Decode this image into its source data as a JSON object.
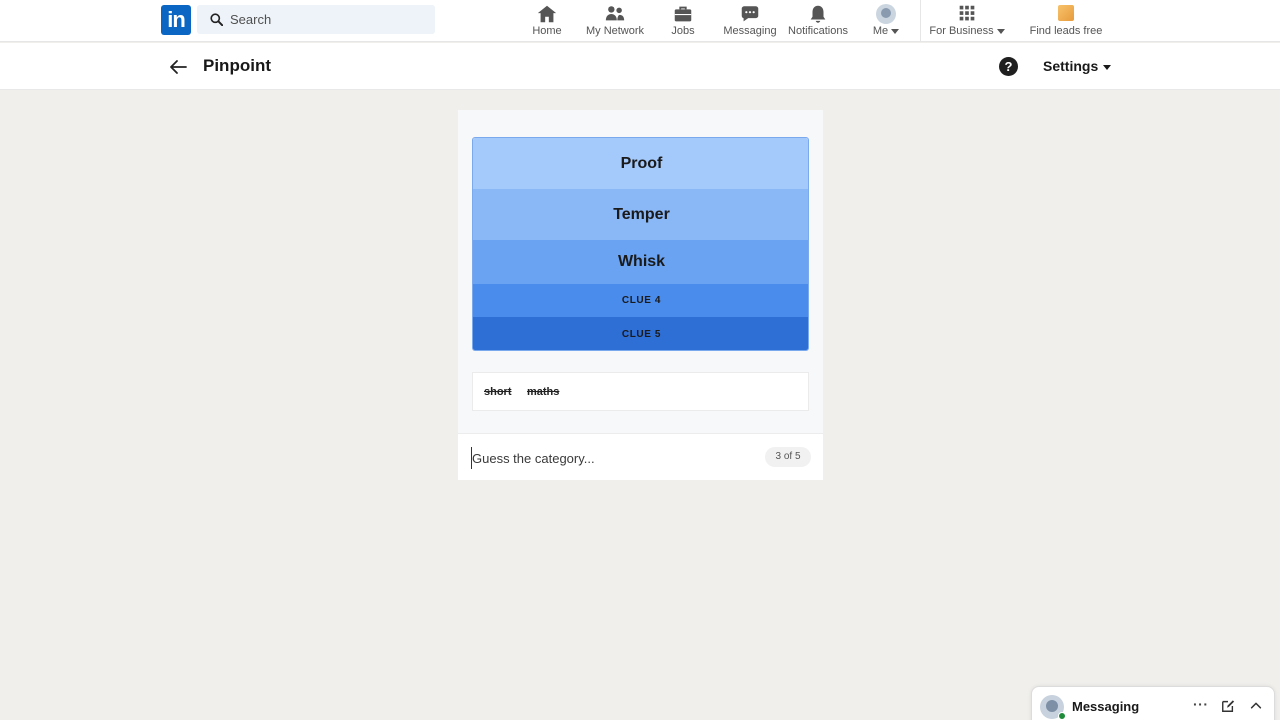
{
  "topnav": {
    "logo_text": "in",
    "search": {
      "placeholder": "Search"
    },
    "items": [
      {
        "label": "Home",
        "icon": "home-icon"
      },
      {
        "label": "My Network",
        "icon": "people-icon"
      },
      {
        "label": "Jobs",
        "icon": "briefcase-icon"
      },
      {
        "label": "Messaging",
        "icon": "chat-icon"
      },
      {
        "label": "Notifications",
        "icon": "bell-icon"
      },
      {
        "label": "Me",
        "icon": "avatar"
      },
      {
        "label": "For Business",
        "icon": "grid-icon"
      },
      {
        "label": "Find leads free",
        "icon": "leads-icon"
      }
    ]
  },
  "header": {
    "title": "Pinpoint",
    "help": "?",
    "settings_label": "Settings"
  },
  "game": {
    "clues": [
      {
        "text": "Proof",
        "revealed": true
      },
      {
        "text": "Temper",
        "revealed": true
      },
      {
        "text": "Whisk",
        "revealed": true
      },
      {
        "text": "CLUE 4",
        "revealed": false
      },
      {
        "text": "CLUE 5",
        "revealed": false
      }
    ],
    "wrong_guesses": [
      "short",
      "maths"
    ],
    "input_placeholder": "Guess the category...",
    "counter": "3 of 5"
  },
  "messaging_widget": {
    "title": "Messaging",
    "more": "···"
  },
  "colors": {
    "brand": "#0a66c2",
    "clue_shades": [
      "#a4c9fb",
      "#8ab7f6",
      "#6aa3f1",
      "#4a8cec",
      "#2e6fd6"
    ]
  }
}
